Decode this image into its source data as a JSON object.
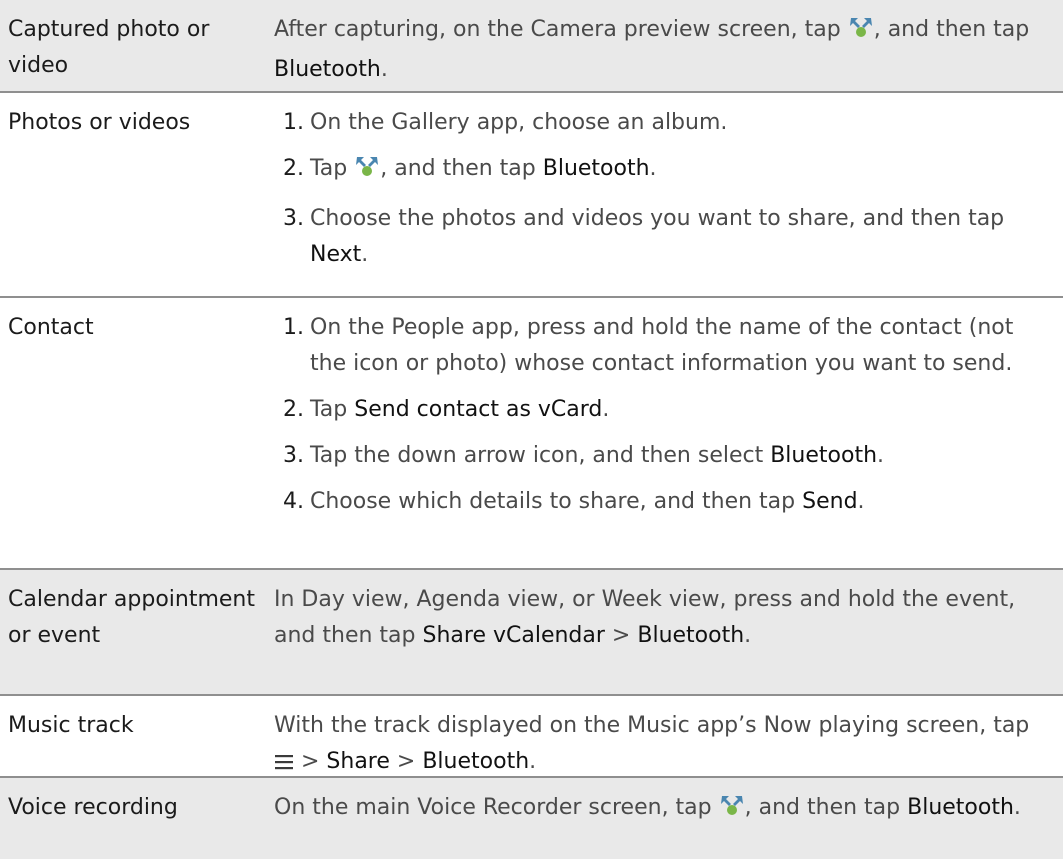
{
  "rows": {
    "captured": {
      "label": "Captured photo or video",
      "t1": "After capturing, on the Camera preview screen, tap ",
      "t2": ", and then tap ",
      "b1": "Bluetooth",
      "t3": "."
    },
    "photos": {
      "label": "Photos or videos",
      "s1": {
        "n": "1.",
        "t": "On the Gallery app, choose an album."
      },
      "s2": {
        "n": "2.",
        "t1": "Tap ",
        "t2": ", and then tap ",
        "b1": "Bluetooth",
        "t3": "."
      },
      "s3": {
        "n": "3.",
        "t1": "Choose the photos and videos you want to share, and then tap ",
        "b1": "Next",
        "t2": "."
      }
    },
    "contact": {
      "label": "Contact",
      "s1": {
        "n": "1.",
        "t": "On the People app, press and hold the name of the contact (not the icon or photo) whose contact information you want to send."
      },
      "s2": {
        "n": "2.",
        "t1": "Tap ",
        "b1": "Send contact as vCard",
        "t2": "."
      },
      "s3": {
        "n": "3.",
        "t1": "Tap the down arrow icon, and then select ",
        "b1": "Bluetooth",
        "t2": "."
      },
      "s4": {
        "n": "4.",
        "t1": "Choose which details to share, and then tap ",
        "b1": "Send",
        "t2": "."
      }
    },
    "calendar": {
      "label": "Calendar appointment or event",
      "t1": "In Day view, Agenda view, or Week view, press and hold the event, and then tap ",
      "b1": "Share vCalendar",
      "sep": " > ",
      "b2": "Bluetooth",
      "t2": "."
    },
    "music": {
      "label": "Music track",
      "t1": "With the track displayed on the Music app’s Now playing screen, tap ",
      "sep1": " > ",
      "b1": "Share",
      "sep2": " > ",
      "b2": "Bluetooth",
      "t2": "."
    },
    "voice": {
      "label": "Voice recording",
      "t1": "On the main Voice Recorder screen, tap ",
      "t2": ", and then tap ",
      "b1": "Bluetooth",
      "t3": "."
    }
  },
  "icons": {
    "share": "share-icon",
    "menu": "menu-icon"
  },
  "colors": {
    "row_shade": "#e9e9e9",
    "divider": "#8f8f8f",
    "icon_blue": "#4a86b0",
    "icon_green": "#7ab648"
  }
}
